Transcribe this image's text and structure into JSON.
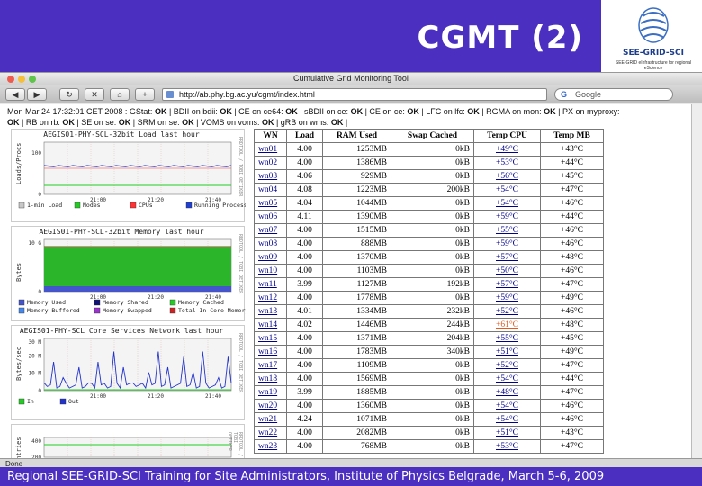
{
  "slide": {
    "title": "CGMT (2)",
    "logo_text": "SEE-GRID-SCI",
    "logo_sub": "SEE-GRID eInfrastructure for regional eScience",
    "footer": "Regional SEE-GRID-SCI Training for Site Administrators, Institute of Physics Belgrade, March 5-6, 2009"
  },
  "browser": {
    "window_title": "Cumulative Grid Monitoring Tool",
    "url": "http://ab.phy.bg.ac.yu/cgmt/index.html",
    "search_placeholder": "Google",
    "status_text": "Done",
    "colors": {
      "band": "#4b2fc0"
    }
  },
  "status": {
    "line1": "Mon Mar 24 17:32:01 CET 2008 : GStat: OK | BDII on bdii: OK | CE on ce64: OK | sBDII on ce: OK | CE on ce: OK | LFC on lfc: OK | RGMA on mon: OK | PX on myproxy:",
    "line2": "OK | RB on rb: OK | SE on se: OK | SRM on se: OK | VOMS on voms: OK | gRB on wms: OK |"
  },
  "graphs": [
    {
      "title": "AEGIS01-PHY-SCL-32bit Load last hour",
      "ylabel": "Loads/Procs",
      "yticks": [
        "100",
        "0"
      ],
      "xticks": [
        "21:00",
        "21:20",
        "21:40"
      ],
      "side": "RRDTOOL / TOBI OETIKER",
      "legend": [
        {
          "label": "1-min Load",
          "color": "#c8c8c8"
        },
        {
          "label": "Nodes",
          "color": "#22cc22"
        },
        {
          "label": "CPUs",
          "color": "#ff3333"
        },
        {
          "label": "Running Processes",
          "color": "#1f3fd0"
        }
      ]
    },
    {
      "title": "AEGIS01-PHY-SCL-32bit Memory last hour",
      "ylabel": "Bytes",
      "yticks": [
        "10 G",
        "0"
      ],
      "xticks": [
        "21:00",
        "21:20",
        "21:40"
      ],
      "side": "RRDTOOL / TOBI OETIKER",
      "legend": [
        {
          "label": "Memory Used",
          "color": "#4455cc"
        },
        {
          "label": "Memory Shared",
          "color": "#111177"
        },
        {
          "label": "Memory Cached",
          "color": "#22cc22"
        },
        {
          "label": "Memory Buffered",
          "color": "#4488ee"
        },
        {
          "label": "Memory Swapped",
          "color": "#9933cc"
        },
        {
          "label": "Total In-Core Memory",
          "color": "#cc2222"
        }
      ]
    },
    {
      "title": "AEGIS01-PHY-SCL Core Services Network last hour",
      "ylabel": "Bytes/sec",
      "yticks": [
        "30 M",
        "20 M",
        "10 M",
        "0"
      ],
      "xticks": [
        "21:00",
        "21:20",
        "21:40"
      ],
      "side": "RRDTOOL / TOBI OETIKER",
      "legend": [
        {
          "label": "In",
          "color": "#22cc22"
        },
        {
          "label": "Out",
          "color": "#2233cc"
        }
      ]
    },
    {
      "title": "",
      "ylabel": "Entries",
      "yticks": [
        "400",
        "200"
      ],
      "xticks": [],
      "side": "RRDTOOL / TOBI OETIKER",
      "legend": []
    }
  ],
  "table": {
    "headers": [
      "WN",
      "Load",
      "RAM Used",
      "Swap Cached",
      "Temp CPU",
      "Temp MB"
    ],
    "rows": [
      [
        "wn01",
        "4.00",
        "1253MB",
        "0kB",
        "+49°C",
        "+43°C"
      ],
      [
        "wn02",
        "4.00",
        "1386MB",
        "0kB",
        "+53°C",
        "+44°C"
      ],
      [
        "wn03",
        "4.06",
        "929MB",
        "0kB",
        "+56°C",
        "+45°C"
      ],
      [
        "wn04",
        "4.08",
        "1223MB",
        "200kB",
        "+54°C",
        "+47°C"
      ],
      [
        "wn05",
        "4.04",
        "1044MB",
        "0kB",
        "+54°C",
        "+46°C"
      ],
      [
        "wn06",
        "4.11",
        "1390MB",
        "0kB",
        "+59°C",
        "+44°C"
      ],
      [
        "wn07",
        "4.00",
        "1515MB",
        "0kB",
        "+55°C",
        "+46°C"
      ],
      [
        "wn08",
        "4.00",
        "888MB",
        "0kB",
        "+59°C",
        "+46°C"
      ],
      [
        "wn09",
        "4.00",
        "1370MB",
        "0kB",
        "+57°C",
        "+48°C"
      ],
      [
        "wn10",
        "4.00",
        "1103MB",
        "0kB",
        "+50°C",
        "+46°C"
      ],
      [
        "wn11",
        "3.99",
        "1127MB",
        "192kB",
        "+57°C",
        "+47°C"
      ],
      [
        "wn12",
        "4.00",
        "1778MB",
        "0kB",
        "+59°C",
        "+49°C"
      ],
      [
        "wn13",
        "4.01",
        "1334MB",
        "232kB",
        "+52°C",
        "+46°C"
      ],
      [
        "wn14",
        "4.02",
        "1446MB",
        "244kB",
        "+61°C",
        "+48°C"
      ],
      [
        "wn15",
        "4.00",
        "1371MB",
        "204kB",
        "+55°C",
        "+45°C"
      ],
      [
        "wn16",
        "4.00",
        "1783MB",
        "340kB",
        "+51°C",
        "+49°C"
      ],
      [
        "wn17",
        "4.00",
        "1109MB",
        "0kB",
        "+52°C",
        "+47°C"
      ],
      [
        "wn18",
        "4.00",
        "1569MB",
        "0kB",
        "+54°C",
        "+44°C"
      ],
      [
        "wn19",
        "3.99",
        "1885MB",
        "0kB",
        "+48°C",
        "+47°C"
      ],
      [
        "wn20",
        "4.00",
        "1360MB",
        "0kB",
        "+54°C",
        "+46°C"
      ],
      [
        "wn21",
        "4.24",
        "1071MB",
        "0kB",
        "+54°C",
        "+46°C"
      ],
      [
        "wn22",
        "4.00",
        "2082MB",
        "0kB",
        "+51°C",
        "+43°C"
      ],
      [
        "wn23",
        "4.00",
        "768MB",
        "0kB",
        "+53°C",
        "+47°C"
      ]
    ],
    "hot_row": "wn14",
    "hot_color": "#e55a1f"
  }
}
